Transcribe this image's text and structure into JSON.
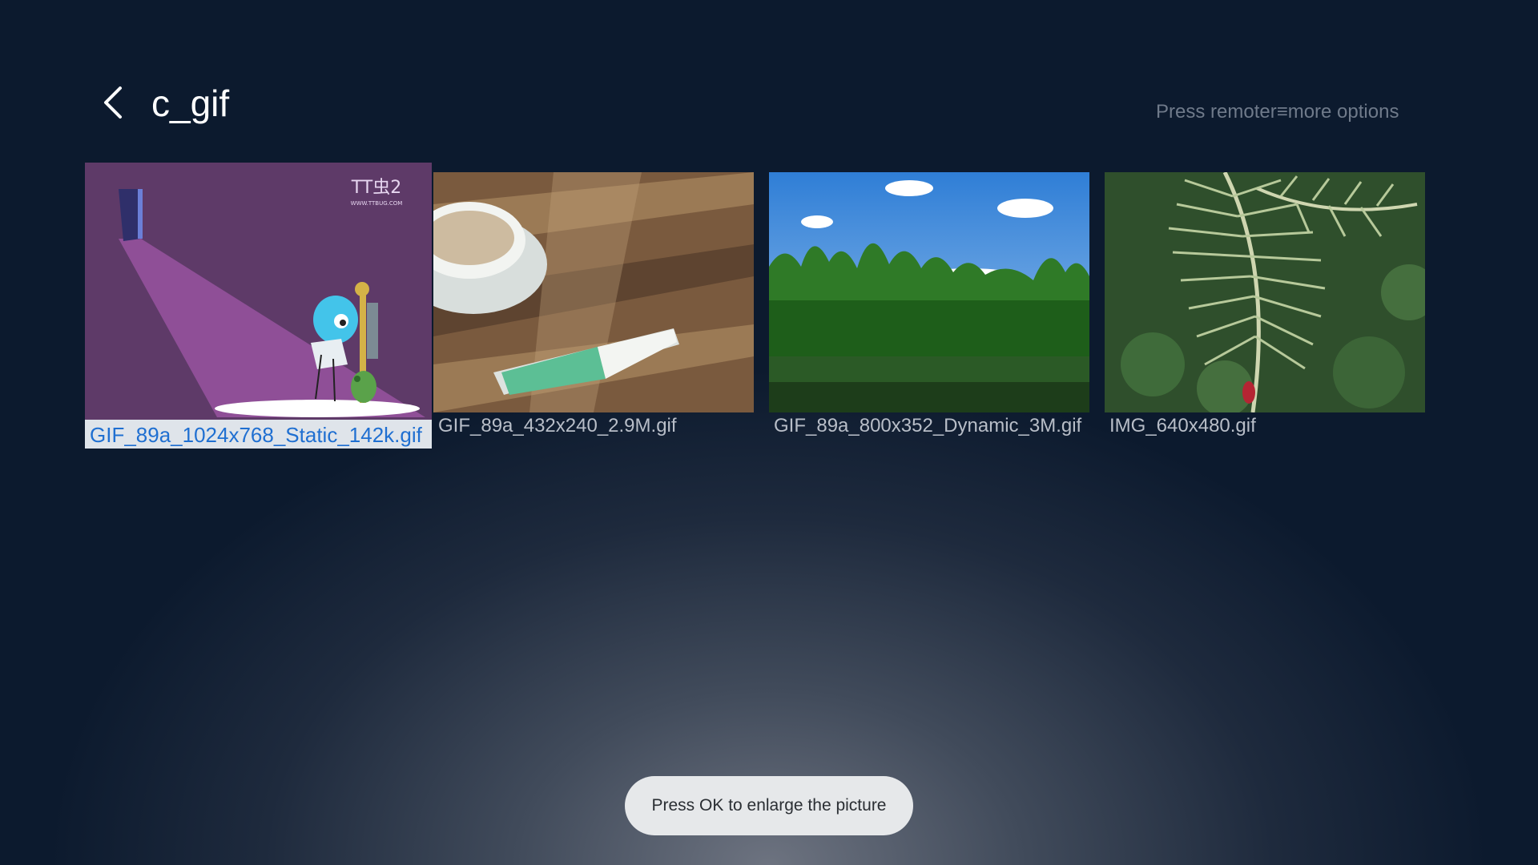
{
  "header": {
    "back_icon": "chevron-left-icon",
    "title": "c_gif",
    "hint": "Press remoter≡more options"
  },
  "files": [
    {
      "name": "GIF_89a_1024x768_Static_142k.gif",
      "focused": true
    },
    {
      "name": "GIF_89a_432x240_2.9M.gif",
      "focused": false
    },
    {
      "name": "GIF_89a_800x352_Dynamic_3M.gif",
      "focused": false
    },
    {
      "name": "IMG_640x480.gif",
      "focused": false
    }
  ],
  "thumbnail_logo": "TT虫2 WWW.TTBUG.COM",
  "toast": {
    "text": "Press OK to enlarge the picture"
  },
  "colors": {
    "background": "#0c1a2e",
    "focus_caption_bg": "#dfe4ea",
    "focus_caption_text": "#1f6fd1",
    "toast_bg": "#e6e8ea"
  }
}
